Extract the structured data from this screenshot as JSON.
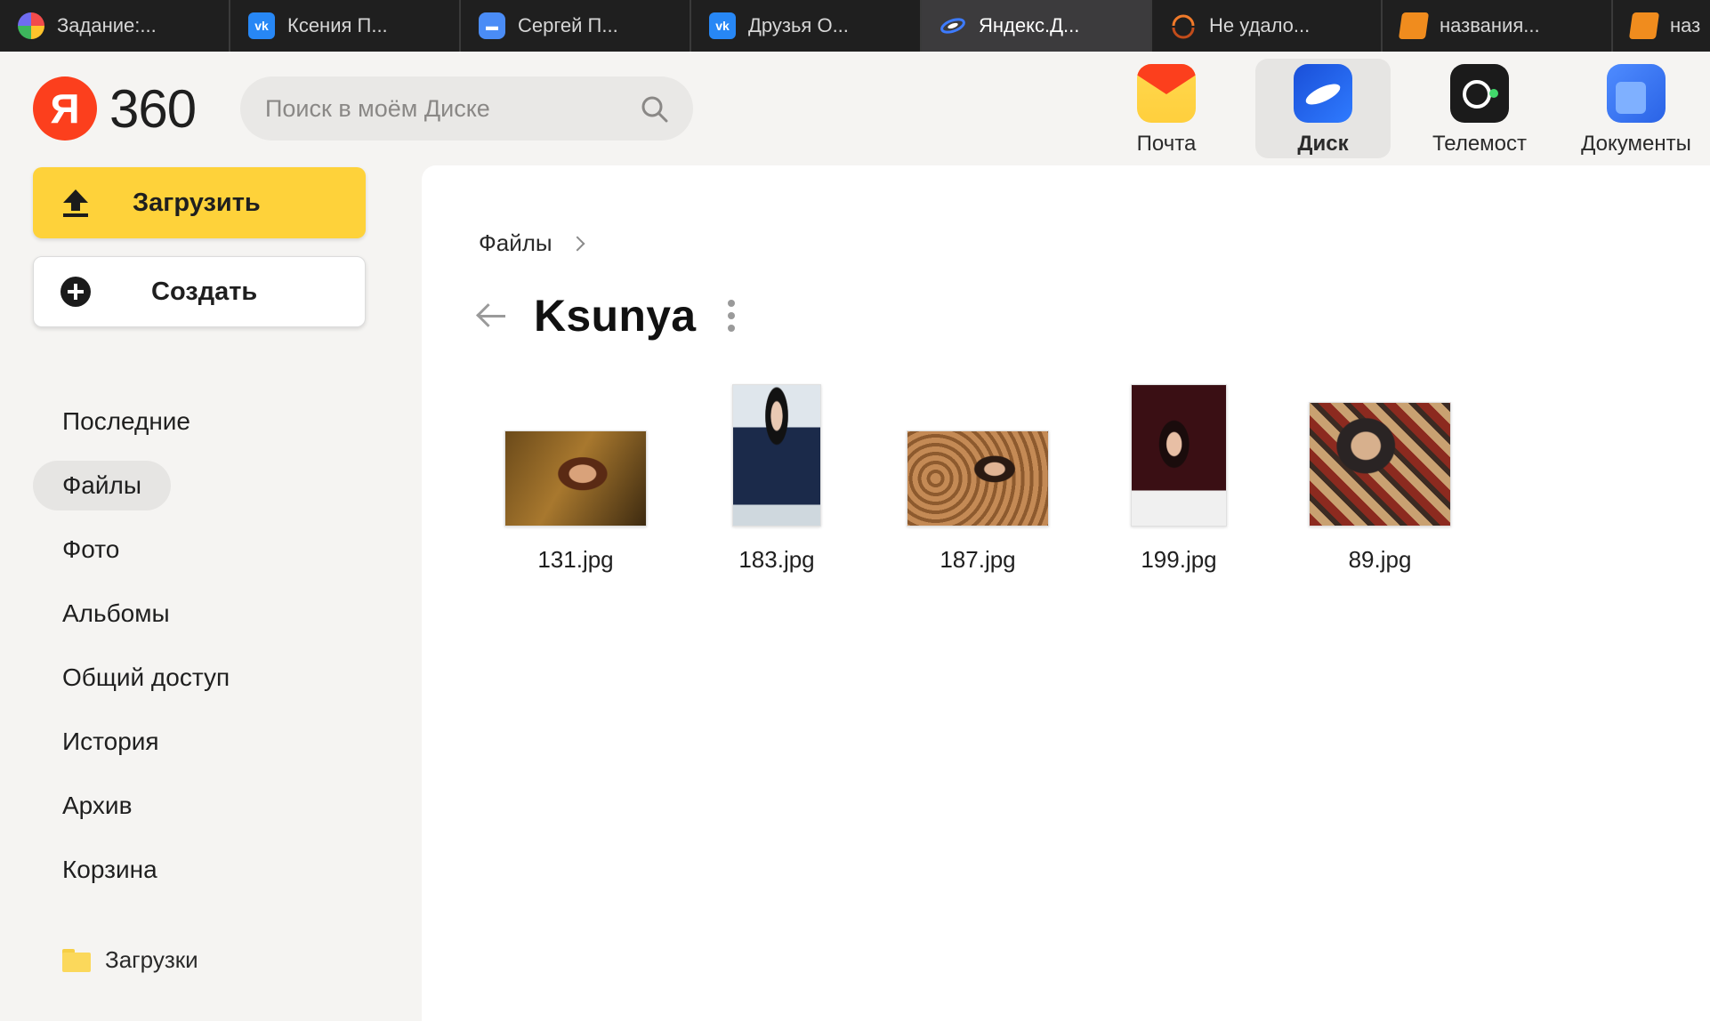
{
  "browser": {
    "tabs": [
      {
        "title": "Задание:...",
        "icon": "multicolor-app-icon",
        "active": false
      },
      {
        "title": "Ксения П...",
        "icon": "vk-icon",
        "active": false
      },
      {
        "title": "Сергей П...",
        "icon": "message-icon",
        "active": false
      },
      {
        "title": "Друзья О...",
        "icon": "vk-icon",
        "active": false
      },
      {
        "title": "Яндекс.Д...",
        "icon": "yandex-disk-icon",
        "active": true
      },
      {
        "title": "Не удало...",
        "icon": "loading-ring-icon",
        "active": false
      },
      {
        "title": "названия...",
        "icon": "book-icon",
        "active": false
      },
      {
        "title": "наз",
        "icon": "book-icon",
        "active": false
      }
    ]
  },
  "header": {
    "logo_letter": "Я",
    "logo_number": "360",
    "search_placeholder": "Поиск в моём Диске",
    "apps": [
      {
        "label": "Почта",
        "icon": "mail-app-icon",
        "active": false
      },
      {
        "label": "Диск",
        "icon": "disk-app-icon",
        "active": true
      },
      {
        "label": "Телемост",
        "icon": "telemost-app-icon",
        "active": false
      },
      {
        "label": "Документы",
        "icon": "documents-app-icon",
        "active": false
      }
    ]
  },
  "sidebar": {
    "upload_label": "Загрузить",
    "create_label": "Создать",
    "nav": [
      {
        "label": "Последние",
        "active": false
      },
      {
        "label": "Файлы",
        "active": true
      },
      {
        "label": "Фото",
        "active": false
      },
      {
        "label": "Альбомы",
        "active": false
      },
      {
        "label": "Общий доступ",
        "active": false
      },
      {
        "label": "История",
        "active": false
      },
      {
        "label": "Архив",
        "active": false
      },
      {
        "label": "Корзина",
        "active": false
      }
    ],
    "folder_label": "Загрузки"
  },
  "main": {
    "breadcrumb": "Файлы",
    "folder_title": "Ksunya",
    "files": [
      {
        "name": "131.jpg"
      },
      {
        "name": "183.jpg"
      },
      {
        "name": "187.jpg"
      },
      {
        "name": "199.jpg"
      },
      {
        "name": "89.jpg"
      }
    ]
  },
  "colors": {
    "accent_yellow": "#fed23a",
    "yandex_red": "#fc3f1d",
    "tabbar_bg": "#1f1f1f"
  }
}
